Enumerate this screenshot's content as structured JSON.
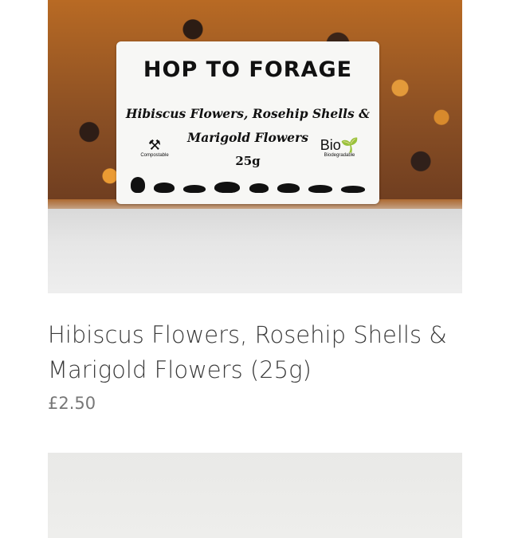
{
  "product": {
    "image_label": {
      "brand": "HOP TO FORAGE",
      "name_line1": "Hibiscus Flowers, Rosehip Shells &",
      "name_line2": "Marigold Flowers",
      "weight": "25g",
      "compostable": "Compostable",
      "bio_mark": "Bio",
      "biodegradable": "Biodegradable"
    },
    "title": "Hibiscus Flowers, Rosehip Shells & Marigold Flowers (25g)",
    "price": "£2.50"
  },
  "colors": {
    "title_text": "#3b3b3b",
    "price_text": "#777777",
    "background": "#ffffff"
  }
}
